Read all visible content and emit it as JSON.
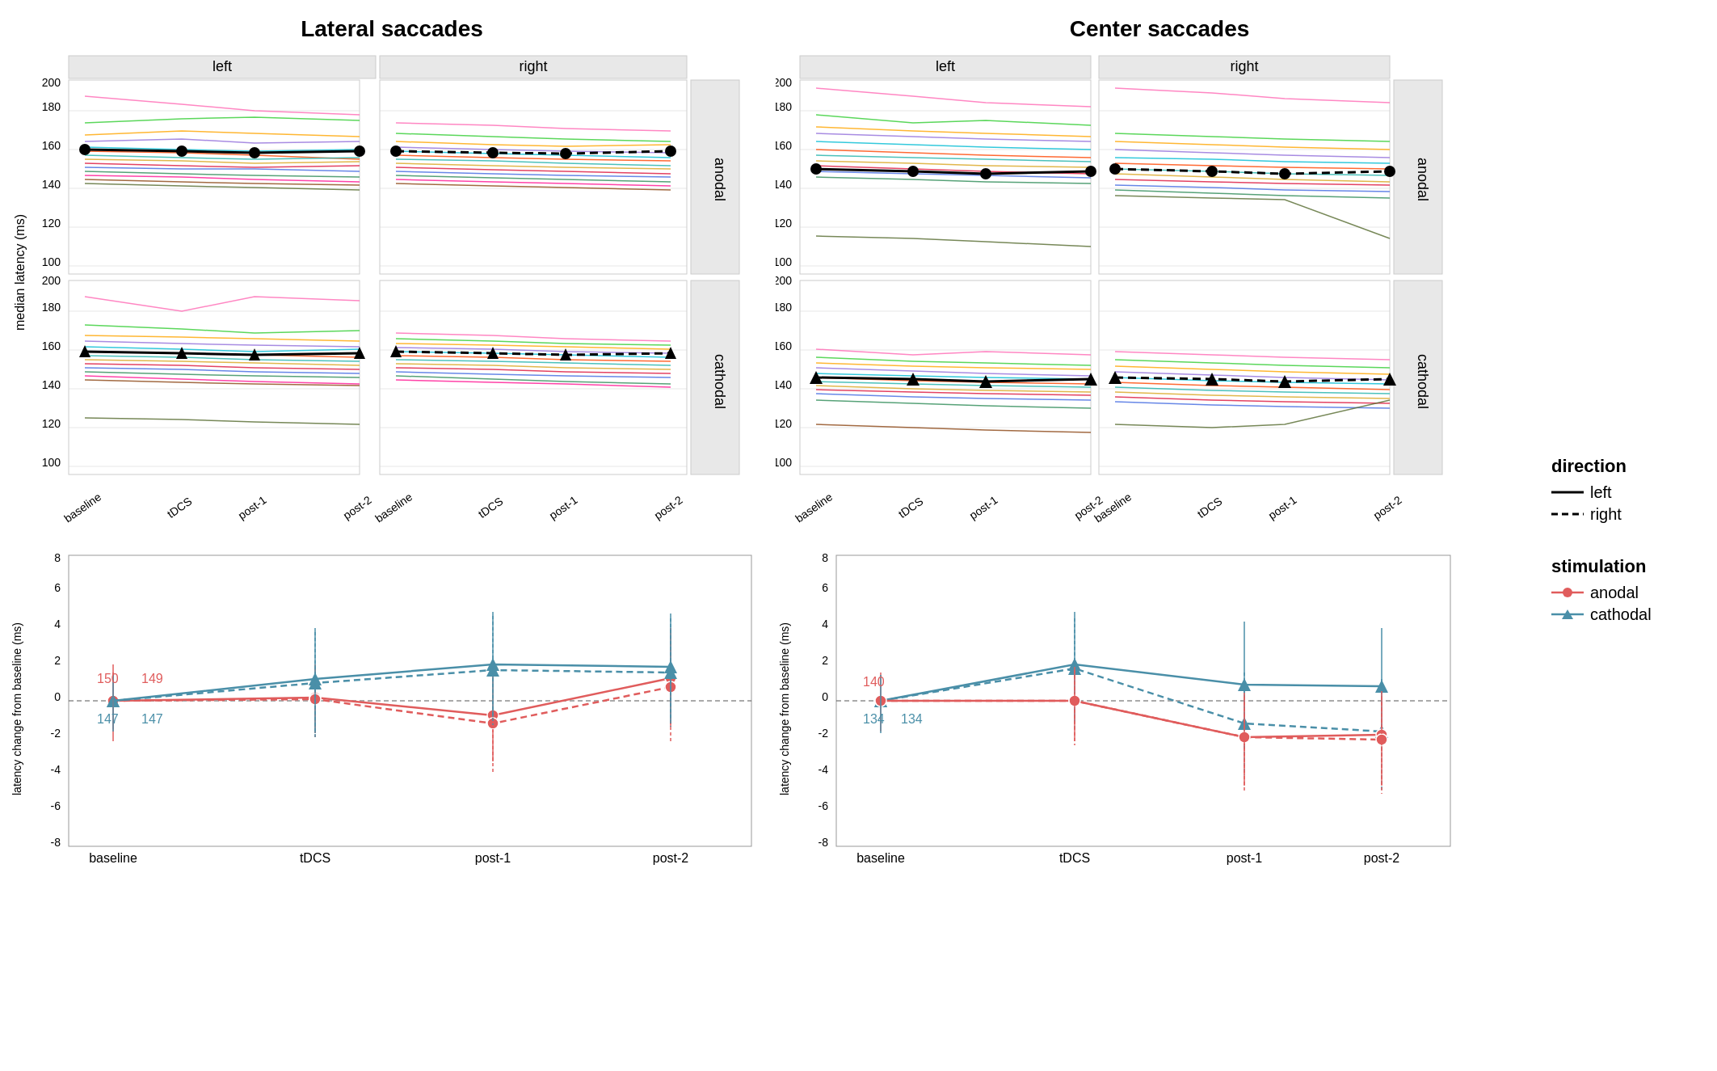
{
  "titles": {
    "left": "Lateral saccades",
    "right": "Center saccades"
  },
  "legend": {
    "direction_title": "direction",
    "direction_items": [
      {
        "label": "left",
        "style": "solid"
      },
      {
        "label": "right",
        "style": "dashed"
      }
    ],
    "stimulation_title": "stimulation",
    "stimulation_items": [
      {
        "label": "anodal",
        "color": "#e05c5c"
      },
      {
        "label": "cathodal",
        "color": "#4a8fa8"
      }
    ]
  },
  "x_labels_top": [
    "baseline",
    "tDCS",
    "post-1",
    "post-2"
  ],
  "x_labels_bottom": [
    "baseline",
    "tDCS",
    "post-1",
    "post-2"
  ],
  "y_labels_top": [
    100,
    120,
    140,
    160,
    180,
    200
  ],
  "y_labels_bottom": [
    -8,
    -6,
    -4,
    -2,
    0,
    2,
    4,
    6,
    8
  ],
  "axis_label_top": "median latency (ms)",
  "axis_label_bottom": "latency change from baseline (ms)",
  "facet_labels": [
    "anodal",
    "cathodal"
  ],
  "col_labels": [
    "left",
    "right"
  ],
  "lateral_bottom": {
    "anodal_values": [
      150,
      149
    ],
    "cathodal_values": [
      147,
      147
    ]
  },
  "center_bottom": {
    "anodal_values": [
      140
    ],
    "cathodal_values": [
      134,
      134
    ]
  }
}
